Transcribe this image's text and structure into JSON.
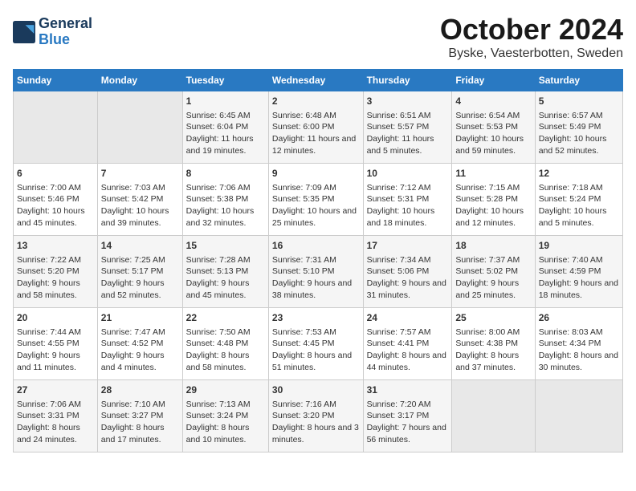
{
  "logo": {
    "general": "General",
    "blue": "Blue"
  },
  "title": "October 2024",
  "subtitle": "Byske, Vaesterbotten, Sweden",
  "weekdays": [
    "Sunday",
    "Monday",
    "Tuesday",
    "Wednesday",
    "Thursday",
    "Friday",
    "Saturday"
  ],
  "weeks": [
    [
      {
        "day": "",
        "empty": true
      },
      {
        "day": "",
        "empty": true
      },
      {
        "day": "1",
        "sunrise": "Sunrise: 6:45 AM",
        "sunset": "Sunset: 6:04 PM",
        "daylight": "Daylight: 11 hours and 19 minutes."
      },
      {
        "day": "2",
        "sunrise": "Sunrise: 6:48 AM",
        "sunset": "Sunset: 6:00 PM",
        "daylight": "Daylight: 11 hours and 12 minutes."
      },
      {
        "day": "3",
        "sunrise": "Sunrise: 6:51 AM",
        "sunset": "Sunset: 5:57 PM",
        "daylight": "Daylight: 11 hours and 5 minutes."
      },
      {
        "day": "4",
        "sunrise": "Sunrise: 6:54 AM",
        "sunset": "Sunset: 5:53 PM",
        "daylight": "Daylight: 10 hours and 59 minutes."
      },
      {
        "day": "5",
        "sunrise": "Sunrise: 6:57 AM",
        "sunset": "Sunset: 5:49 PM",
        "daylight": "Daylight: 10 hours and 52 minutes."
      }
    ],
    [
      {
        "day": "6",
        "sunrise": "Sunrise: 7:00 AM",
        "sunset": "Sunset: 5:46 PM",
        "daylight": "Daylight: 10 hours and 45 minutes."
      },
      {
        "day": "7",
        "sunrise": "Sunrise: 7:03 AM",
        "sunset": "Sunset: 5:42 PM",
        "daylight": "Daylight: 10 hours and 39 minutes."
      },
      {
        "day": "8",
        "sunrise": "Sunrise: 7:06 AM",
        "sunset": "Sunset: 5:38 PM",
        "daylight": "Daylight: 10 hours and 32 minutes."
      },
      {
        "day": "9",
        "sunrise": "Sunrise: 7:09 AM",
        "sunset": "Sunset: 5:35 PM",
        "daylight": "Daylight: 10 hours and 25 minutes."
      },
      {
        "day": "10",
        "sunrise": "Sunrise: 7:12 AM",
        "sunset": "Sunset: 5:31 PM",
        "daylight": "Daylight: 10 hours and 18 minutes."
      },
      {
        "day": "11",
        "sunrise": "Sunrise: 7:15 AM",
        "sunset": "Sunset: 5:28 PM",
        "daylight": "Daylight: 10 hours and 12 minutes."
      },
      {
        "day": "12",
        "sunrise": "Sunrise: 7:18 AM",
        "sunset": "Sunset: 5:24 PM",
        "daylight": "Daylight: 10 hours and 5 minutes."
      }
    ],
    [
      {
        "day": "13",
        "sunrise": "Sunrise: 7:22 AM",
        "sunset": "Sunset: 5:20 PM",
        "daylight": "Daylight: 9 hours and 58 minutes."
      },
      {
        "day": "14",
        "sunrise": "Sunrise: 7:25 AM",
        "sunset": "Sunset: 5:17 PM",
        "daylight": "Daylight: 9 hours and 52 minutes."
      },
      {
        "day": "15",
        "sunrise": "Sunrise: 7:28 AM",
        "sunset": "Sunset: 5:13 PM",
        "daylight": "Daylight: 9 hours and 45 minutes."
      },
      {
        "day": "16",
        "sunrise": "Sunrise: 7:31 AM",
        "sunset": "Sunset: 5:10 PM",
        "daylight": "Daylight: 9 hours and 38 minutes."
      },
      {
        "day": "17",
        "sunrise": "Sunrise: 7:34 AM",
        "sunset": "Sunset: 5:06 PM",
        "daylight": "Daylight: 9 hours and 31 minutes."
      },
      {
        "day": "18",
        "sunrise": "Sunrise: 7:37 AM",
        "sunset": "Sunset: 5:02 PM",
        "daylight": "Daylight: 9 hours and 25 minutes."
      },
      {
        "day": "19",
        "sunrise": "Sunrise: 7:40 AM",
        "sunset": "Sunset: 4:59 PM",
        "daylight": "Daylight: 9 hours and 18 minutes."
      }
    ],
    [
      {
        "day": "20",
        "sunrise": "Sunrise: 7:44 AM",
        "sunset": "Sunset: 4:55 PM",
        "daylight": "Daylight: 9 hours and 11 minutes."
      },
      {
        "day": "21",
        "sunrise": "Sunrise: 7:47 AM",
        "sunset": "Sunset: 4:52 PM",
        "daylight": "Daylight: 9 hours and 4 minutes."
      },
      {
        "day": "22",
        "sunrise": "Sunrise: 7:50 AM",
        "sunset": "Sunset: 4:48 PM",
        "daylight": "Daylight: 8 hours and 58 minutes."
      },
      {
        "day": "23",
        "sunrise": "Sunrise: 7:53 AM",
        "sunset": "Sunset: 4:45 PM",
        "daylight": "Daylight: 8 hours and 51 minutes."
      },
      {
        "day": "24",
        "sunrise": "Sunrise: 7:57 AM",
        "sunset": "Sunset: 4:41 PM",
        "daylight": "Daylight: 8 hours and 44 minutes."
      },
      {
        "day": "25",
        "sunrise": "Sunrise: 8:00 AM",
        "sunset": "Sunset: 4:38 PM",
        "daylight": "Daylight: 8 hours and 37 minutes."
      },
      {
        "day": "26",
        "sunrise": "Sunrise: 8:03 AM",
        "sunset": "Sunset: 4:34 PM",
        "daylight": "Daylight: 8 hours and 30 minutes."
      }
    ],
    [
      {
        "day": "27",
        "sunrise": "Sunrise: 7:06 AM",
        "sunset": "Sunset: 3:31 PM",
        "daylight": "Daylight: 8 hours and 24 minutes."
      },
      {
        "day": "28",
        "sunrise": "Sunrise: 7:10 AM",
        "sunset": "Sunset: 3:27 PM",
        "daylight": "Daylight: 8 hours and 17 minutes."
      },
      {
        "day": "29",
        "sunrise": "Sunrise: 7:13 AM",
        "sunset": "Sunset: 3:24 PM",
        "daylight": "Daylight: 8 hours and 10 minutes."
      },
      {
        "day": "30",
        "sunrise": "Sunrise: 7:16 AM",
        "sunset": "Sunset: 3:20 PM",
        "daylight": "Daylight: 8 hours and 3 minutes."
      },
      {
        "day": "31",
        "sunrise": "Sunrise: 7:20 AM",
        "sunset": "Sunset: 3:17 PM",
        "daylight": "Daylight: 7 hours and 56 minutes."
      },
      {
        "day": "",
        "empty": true
      },
      {
        "day": "",
        "empty": true
      }
    ]
  ]
}
